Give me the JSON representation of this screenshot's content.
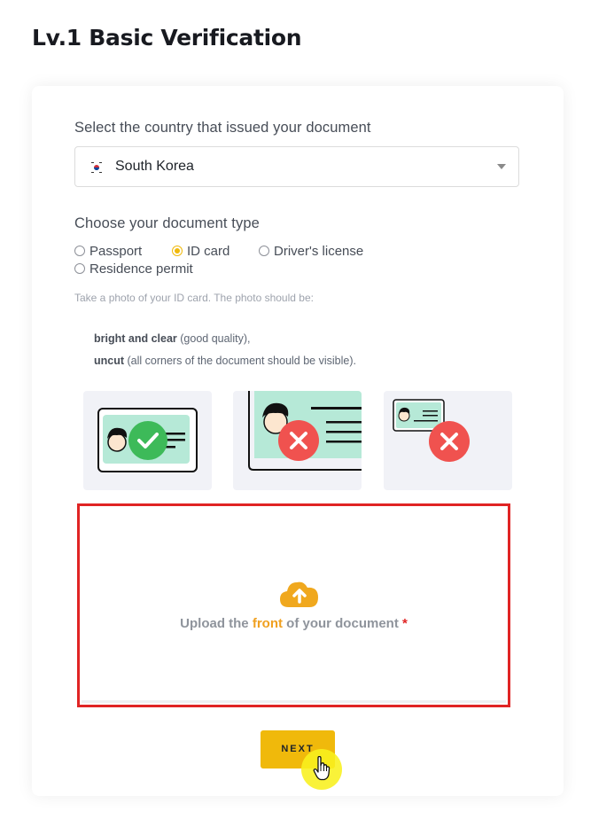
{
  "page": {
    "title": "Lv.1 Basic Verification"
  },
  "country": {
    "label": "Select the country that issued your document",
    "selected": "South Korea",
    "flag_icon": "south-korea-flag"
  },
  "document_type": {
    "label": "Choose your document type",
    "options": [
      {
        "label": "Passport",
        "checked": false
      },
      {
        "label": "ID card",
        "checked": true
      },
      {
        "label": "Driver's license",
        "checked": false
      },
      {
        "label": "Residence permit",
        "checked": false
      }
    ]
  },
  "instructions": {
    "hint": "Take a photo of your ID card. The photo should be:",
    "req1_bold": "bright and clear",
    "req1_rest": " (good quality),",
    "req2_bold": "uncut",
    "req2_rest": " (all corners of the document should be visible)."
  },
  "examples": [
    {
      "icon": "check-icon",
      "status": "good"
    },
    {
      "icon": "close-icon",
      "status": "bad-cropped"
    },
    {
      "icon": "close-icon",
      "status": "bad-too-small"
    }
  ],
  "upload": {
    "text_before": "Upload the ",
    "text_accent": "front",
    "text_after": " of your document ",
    "required_mark": "*",
    "icon": "cloud-upload-icon"
  },
  "next_button": {
    "label": "NEXT"
  },
  "colors": {
    "accent": "#f0b90b",
    "error": "#e02424",
    "good": "#3dba59",
    "bad": "#f0524f",
    "card_bg": "#b6e9d7"
  }
}
